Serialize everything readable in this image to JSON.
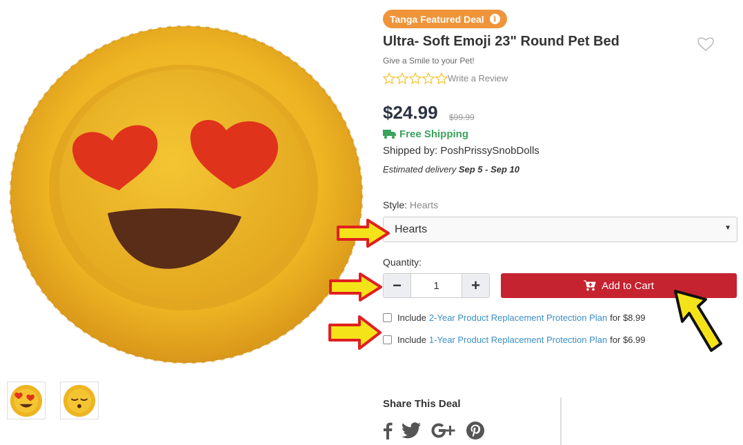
{
  "badge": {
    "label": "Tanga Featured Deal",
    "info_glyph": "i",
    "color": "#f0943a"
  },
  "product": {
    "title": "Ultra- Soft Emoji 23\" Round Pet Bed",
    "tagline": "Give a Smile to your Pet!",
    "review_link": "Write a Review",
    "rating_stars": 0,
    "price": "$24.99",
    "old_price": "$99.99",
    "free_shipping": "Free Shipping",
    "shipped_by": "Shipped by: PoshPrissySnobDolls",
    "delivery_prefix": "Estimated delivery",
    "delivery_dates": "Sep 5 - Sep 10"
  },
  "style": {
    "label": "Style:",
    "value": "Hearts",
    "selected": "Hearts"
  },
  "quantity": {
    "label": "Quantity:",
    "value": "1",
    "minus": "−",
    "plus": "+"
  },
  "cart": {
    "label": "Add to Cart",
    "color": "#c4232f"
  },
  "plans": [
    {
      "prefix": "Include",
      "link": "2-Year Product Replacement Protection Plan",
      "suffix": "for $8.99"
    },
    {
      "prefix": "Include",
      "link": "1-Year Product Replacement Protection Plan",
      "suffix": "for $6.99"
    }
  ],
  "share": {
    "title": "Share This Deal",
    "icons": [
      "facebook-icon",
      "twitter-icon",
      "google-plus-icon",
      "pinterest-icon"
    ]
  },
  "colors": {
    "price": "#2b3240",
    "shipping": "#3aa35c",
    "link": "#3b8fc4",
    "arrow_fill": "#f5e31a",
    "arrow_stroke": "#e02020"
  }
}
